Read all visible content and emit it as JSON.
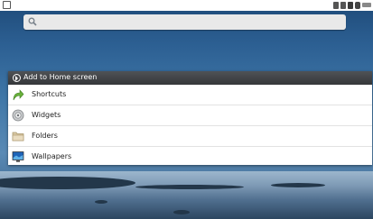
{
  "status_bar": {
    "icons": [
      "app-notification-icon",
      "sd-card-icon",
      "usb-icon",
      "signal-icon",
      "battery-icon",
      "clock-icon"
    ]
  },
  "search": {
    "icon": "search-icon"
  },
  "dialog": {
    "title": "Add to Home screen",
    "title_icon": "add-icon",
    "items": [
      {
        "label": "Shortcuts",
        "icon": "shortcut-arrow-icon"
      },
      {
        "label": "Widgets",
        "icon": "widgets-icon"
      },
      {
        "label": "Folders",
        "icon": "folder-icon"
      },
      {
        "label": "Wallpapers",
        "icon": "wallpaper-icon"
      }
    ]
  }
}
